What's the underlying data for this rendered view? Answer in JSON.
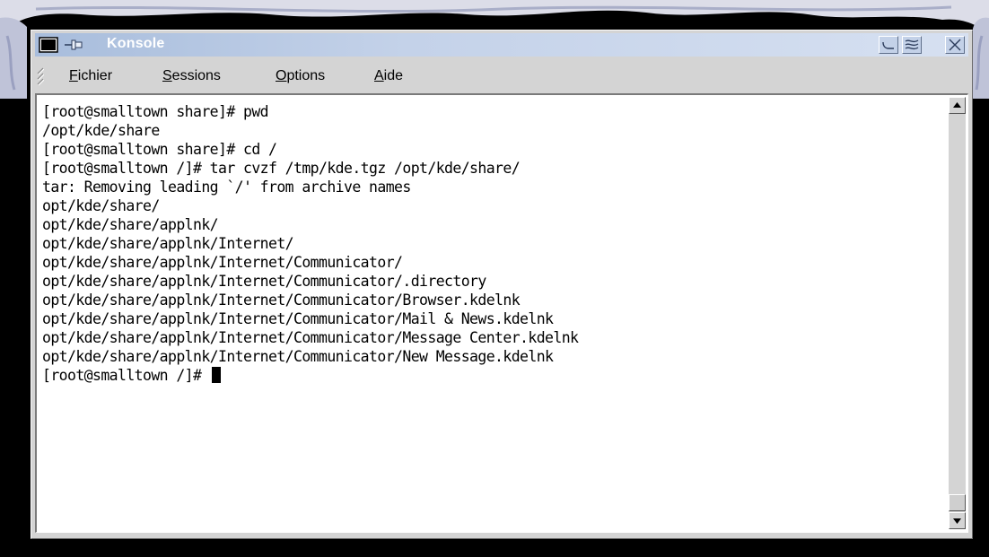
{
  "window": {
    "title": "Konsole"
  },
  "menubar": {
    "items": [
      {
        "accel": "F",
        "rest": "ichier"
      },
      {
        "accel": "S",
        "rest": "essions"
      },
      {
        "accel": "O",
        "rest": "ptions"
      },
      {
        "accel": "A",
        "rest": "ide"
      }
    ]
  },
  "terminal": {
    "lines": [
      "[root@smalltown share]# pwd",
      "/opt/kde/share",
      "[root@smalltown share]# cd /",
      "[root@smalltown /]# tar cvzf /tmp/kde.tgz /opt/kde/share/",
      "tar: Removing leading `/' from archive names",
      "opt/kde/share/",
      "opt/kde/share/applnk/",
      "opt/kde/share/applnk/Internet/",
      "opt/kde/share/applnk/Internet/Communicator/",
      "opt/kde/share/applnk/Internet/Communicator/.directory",
      "opt/kde/share/applnk/Internet/Communicator/Browser.kdelnk",
      "opt/kde/share/applnk/Internet/Communicator/Mail & News.kdelnk",
      "opt/kde/share/applnk/Internet/Communicator/Message Center.kdelnk",
      "opt/kde/share/applnk/Internet/Communicator/New Message.kdelnk"
    ],
    "prompt": "[root@smalltown /]# "
  },
  "icons": {
    "window_menu": "window-menu-icon",
    "pin": "pin-icon",
    "minimize": "minimize-icon",
    "maximize": "maximize-icon",
    "close": "close-icon",
    "scroll_up": "arrow-up-icon",
    "scroll_down": "arrow-down-icon"
  },
  "colors": {
    "titlebar": "#b4c6e2",
    "window_bg": "#d4d4d4",
    "terminal_bg": "#ffffff",
    "terminal_fg": "#000000"
  }
}
